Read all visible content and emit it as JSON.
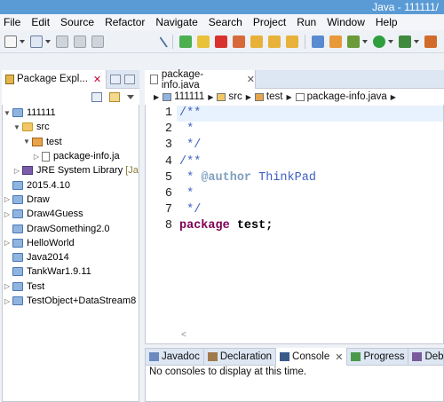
{
  "window": {
    "title": "Java - 111111/"
  },
  "menu": [
    "File",
    "Edit",
    "Source",
    "Refactor",
    "Navigate",
    "Search",
    "Project",
    "Run",
    "Window",
    "Help"
  ],
  "explorer": {
    "tab_label": "Package Expl...",
    "items": [
      {
        "label": "111111",
        "depth": 0,
        "expander": "▼",
        "icon": "project-icon"
      },
      {
        "label": "src",
        "depth": 1,
        "expander": "▼",
        "icon": "source-folder-icon"
      },
      {
        "label": "test",
        "depth": 2,
        "expander": "▼",
        "icon": "package-icon"
      },
      {
        "label": "package-info.ja",
        "depth": 3,
        "expander": "▷",
        "icon": "java-file-icon"
      },
      {
        "label": "JRE System Library",
        "suffix": "[Ja",
        "depth": 1,
        "expander": "▷",
        "icon": "library-icon"
      },
      {
        "label": "2015.4.10",
        "depth": 0,
        "expander": "",
        "icon": "project-icon"
      },
      {
        "label": "Draw",
        "depth": 0,
        "expander": "▷",
        "icon": "project-icon"
      },
      {
        "label": "Draw4Guess",
        "depth": 0,
        "expander": "▷",
        "icon": "project-icon"
      },
      {
        "label": "DrawSomething2.0",
        "depth": 0,
        "expander": "",
        "icon": "project-icon"
      },
      {
        "label": "HelloWorld",
        "depth": 0,
        "expander": "▷",
        "icon": "project-icon"
      },
      {
        "label": "Java2014",
        "depth": 0,
        "expander": "",
        "icon": "project-icon"
      },
      {
        "label": "TankWar1.9.11",
        "depth": 0,
        "expander": "",
        "icon": "project-icon"
      },
      {
        "label": "Test",
        "depth": 0,
        "expander": "▷",
        "icon": "project-icon"
      },
      {
        "label": "TestObject+DataStream8",
        "depth": 0,
        "expander": "▷",
        "icon": "project-icon"
      }
    ]
  },
  "editor": {
    "tab_label": "package-info.java",
    "breadcrumb": [
      "111111",
      "src",
      "test",
      "package-info.java"
    ],
    "line_numbers": [
      "1",
      "2",
      "3",
      "4",
      "5",
      "6",
      "7",
      "8"
    ],
    "lines": [
      [
        {
          "t": "/**",
          "c": "c-doc"
        }
      ],
      [
        {
          "t": " *",
          "c": "c-doc"
        }
      ],
      [
        {
          "t": " */",
          "c": "c-doc"
        }
      ],
      [
        {
          "t": "/**",
          "c": "c-doc"
        }
      ],
      [
        {
          "t": " * ",
          "c": "c-doc"
        },
        {
          "t": "@author",
          "c": "c-tag"
        },
        {
          "t": " ThinkPad",
          "c": "c-doc"
        }
      ],
      [
        {
          "t": " *",
          "c": "c-doc"
        }
      ],
      [
        {
          "t": " */",
          "c": "c-doc"
        }
      ],
      [
        {
          "t": "package",
          "c": "c-kw"
        },
        {
          "t": " test;",
          "c": "c-txt c-bold"
        }
      ]
    ]
  },
  "bottom": {
    "tabs": [
      "Javadoc",
      "Declaration",
      "Console",
      "Progress",
      "Debug"
    ],
    "active_tab": "Console",
    "console_message": "No consoles to display at this time."
  }
}
